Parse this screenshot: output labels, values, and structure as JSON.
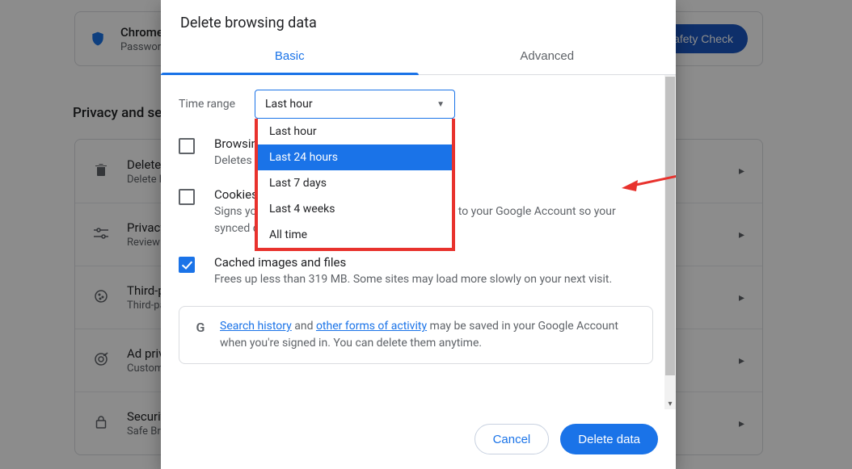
{
  "background": {
    "card_title": "Chrome found some safety recommendations for your review",
    "card_sub": "Password Manager, Safe Browsing",
    "safety_btn": "Go to Safety Check",
    "section_title": "Privacy and security",
    "rows": [
      {
        "title": "Delete browsing data",
        "sub": "Delete history, cookies, cache, and more"
      },
      {
        "title": "Privacy Guide",
        "sub": "Review key privacy and security controls"
      },
      {
        "title": "Third-party cookies",
        "sub": "Third-party cookies are blocked in Incognito mode"
      },
      {
        "title": "Ad privacy",
        "sub": "Customize the info used by sites to show you ads"
      },
      {
        "title": "Security",
        "sub": "Safe Browsing (protection from dangerous sites) and other security settings"
      }
    ]
  },
  "dialog": {
    "title": "Delete browsing data",
    "tabs": {
      "basic": "Basic",
      "advanced": "Advanced"
    },
    "time_label": "Time range",
    "time_selected": "Last hour",
    "time_options": [
      "Last hour",
      "Last 24 hours",
      "Last 7 days",
      "Last 4 weeks",
      "All time"
    ],
    "time_highlight_index": 1,
    "options": [
      {
        "title": "Browsing history",
        "sub": "Deletes history, including in the search box"
      },
      {
        "title": "Cookies and other site data",
        "sub": "Signs you out of most sites. You'll stay signed in to your Google Account so your synced data can be deleted."
      },
      {
        "title": "Cached images and files",
        "sub": "Frees up less than 319 MB. Some sites may load more slowly on your next visit."
      }
    ],
    "info_link1": "Search history",
    "info_mid1": " and ",
    "info_link2": "other forms of activity",
    "info_rest": " may be saved in your Google Account when you're signed in. You can delete them anytime.",
    "cancel": "Cancel",
    "delete": "Delete data"
  }
}
